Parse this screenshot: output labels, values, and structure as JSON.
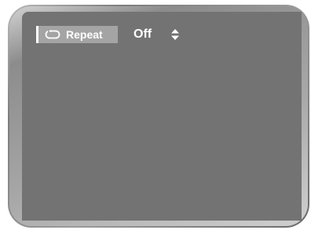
{
  "menu": {
    "repeat_label": "Repeat",
    "repeat_value": "Off",
    "repeat_icon": "repeat-icon",
    "adjust_icon": "up-down-arrows-icon"
  },
  "colors": {
    "screen": "#737373",
    "highlight": "#a4a4a4",
    "text": "#ffffff"
  }
}
